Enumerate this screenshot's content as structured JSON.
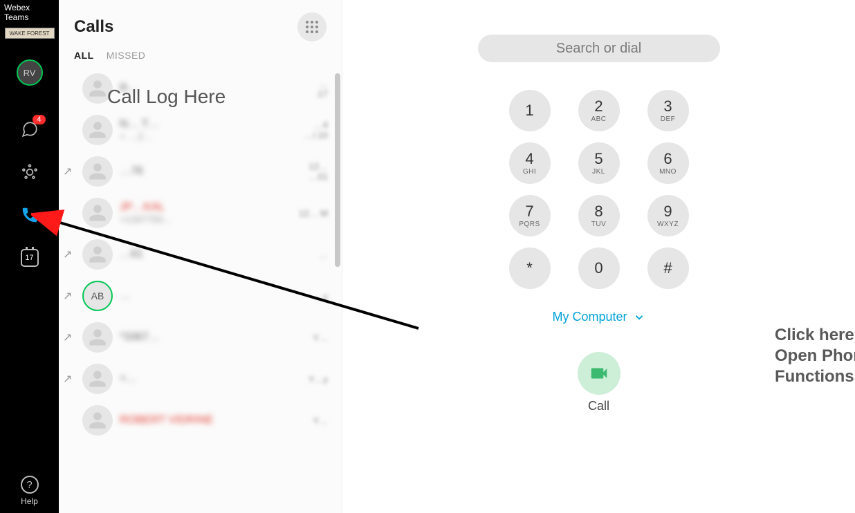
{
  "app": {
    "name": "Webex Teams",
    "org_label": "WAKE FOREST"
  },
  "rail": {
    "user_initials": "RV",
    "messages_badge": "4",
    "calendar_day": "17",
    "help_label": "Help"
  },
  "calls_panel": {
    "title": "Calls",
    "tabs": {
      "all": "ALL",
      "missed": "MISSED"
    },
    "overlay": "Call Log Here",
    "entries": [
      {
        "name": "R…",
        "number": "",
        "time_top": "…",
        "time_bot": ".17",
        "direction": "in",
        "missed": false,
        "avatar": ""
      },
      {
        "name": "N… T…",
        "number": "+ …2…",
        "time_top": "…4",
        "time_bot": "…/.10",
        "direction": "in",
        "missed": false,
        "avatar": ""
      },
      {
        "name": "…76",
        "number": "",
        "time_top": "12…",
        "time_bot": "…01",
        "direction": "out",
        "missed": false,
        "avatar": ""
      },
      {
        "name": "JP…KAL",
        "number": "+1347750…",
        "time_top": "12… M",
        "time_bot": "",
        "direction": "in",
        "missed": true,
        "avatar": ""
      },
      {
        "name": "…61",
        "number": "",
        "time_top": "…",
        "time_bot": "",
        "direction": "out",
        "missed": false,
        "avatar": ""
      },
      {
        "name": "…",
        "number": "",
        "time_top": "…y",
        "time_bot": "",
        "direction": "out",
        "missed": false,
        "avatar": "AB"
      },
      {
        "name": "*3367…",
        "number": "",
        "time_top": "Y…",
        "time_bot": "",
        "direction": "out",
        "missed": false,
        "avatar": ""
      },
      {
        "name": "+…",
        "number": "",
        "time_top": "Y…y",
        "time_bot": "",
        "direction": "out",
        "missed": false,
        "avatar": ""
      },
      {
        "name": "ROBERT VIDRINE",
        "number": "",
        "time_top": "Y…",
        "time_bot": "",
        "direction": "in",
        "missed": true,
        "avatar": ""
      }
    ]
  },
  "dialer": {
    "search_placeholder": "Search or dial",
    "keys": [
      {
        "digit": "1",
        "letters": ""
      },
      {
        "digit": "2",
        "letters": "ABC"
      },
      {
        "digit": "3",
        "letters": "DEF"
      },
      {
        "digit": "4",
        "letters": "GHI"
      },
      {
        "digit": "5",
        "letters": "JKL"
      },
      {
        "digit": "6",
        "letters": "MNO"
      },
      {
        "digit": "7",
        "letters": "PQRS"
      },
      {
        "digit": "8",
        "letters": "TUV"
      },
      {
        "digit": "9",
        "letters": "WXYZ"
      },
      {
        "digit": "*",
        "letters": ""
      },
      {
        "digit": "0",
        "letters": ""
      },
      {
        "digit": "#",
        "letters": ""
      }
    ],
    "device_label": "My Computer",
    "call_label": "Call"
  },
  "annotation": {
    "text": "Click here to Open Phone Functions"
  }
}
